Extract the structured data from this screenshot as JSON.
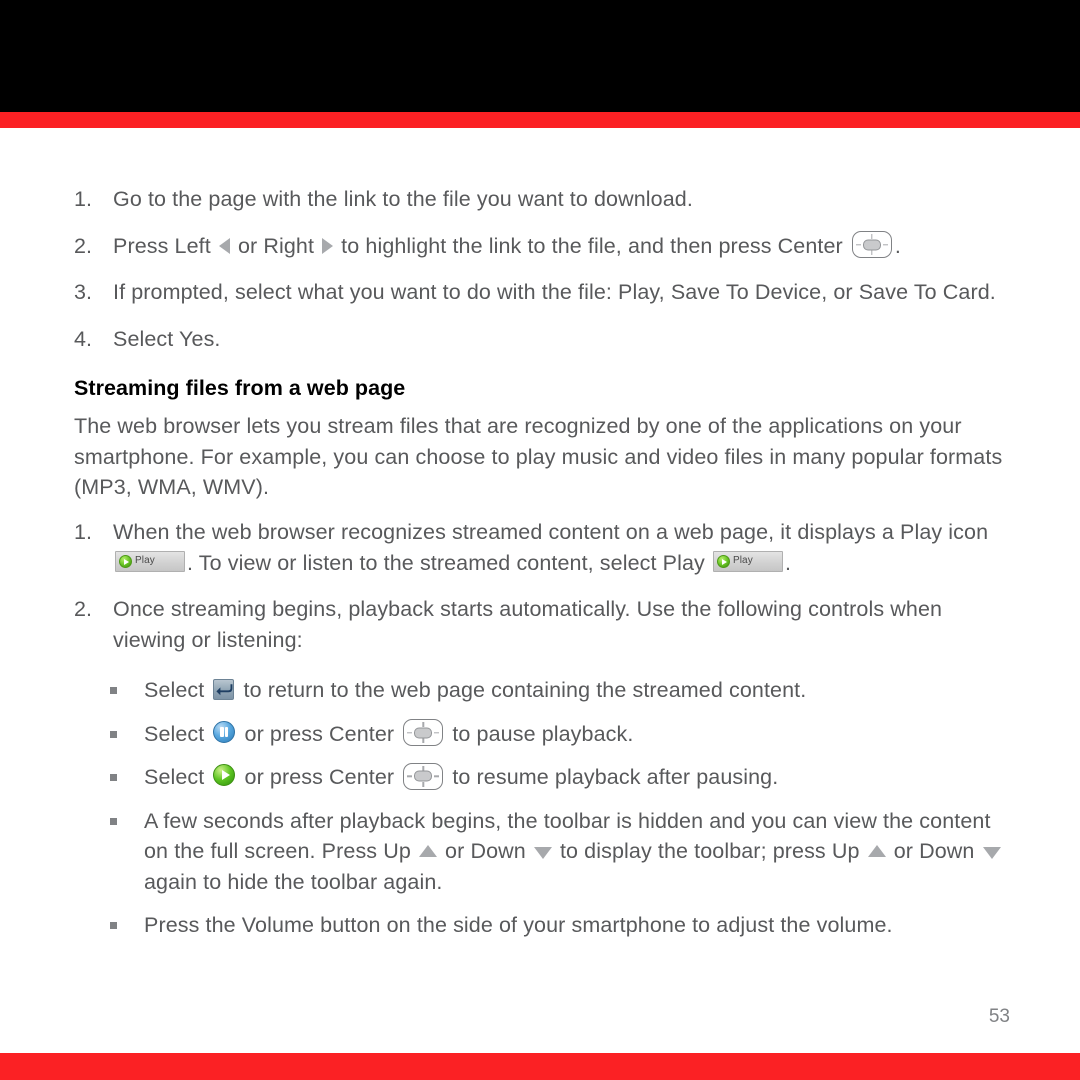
{
  "page": {
    "number": "53",
    "top_band_color": "#000000",
    "accent_color": "#fb2124",
    "body_text_color": "#58595b",
    "heading_text_color": "#000000"
  },
  "steps_download": [
    {
      "number": "1.",
      "parts": [
        {
          "type": "text",
          "value": "Go to the page with the link to the file you want to download."
        }
      ]
    },
    {
      "number": "2.",
      "parts": [
        {
          "type": "text",
          "value": "Press Left "
        },
        {
          "type": "icon",
          "icon": "left-arrow-icon"
        },
        {
          "type": "text",
          "value": " or Right "
        },
        {
          "type": "icon",
          "icon": "right-arrow-icon"
        },
        {
          "type": "text",
          "value": " to highlight the link to the file, and then press Center "
        },
        {
          "type": "icon",
          "icon": "center-dpad-icon"
        },
        {
          "type": "text",
          "value": "."
        }
      ]
    },
    {
      "number": "3.",
      "parts": [
        {
          "type": "text",
          "value": "If prompted, select what you want to do with the file: Play, Save To Device, or Save To Card."
        }
      ]
    },
    {
      "number": "4.",
      "parts": [
        {
          "type": "text",
          "value": "Select Yes."
        }
      ]
    }
  ],
  "section": {
    "heading": "Streaming files from a web page",
    "intro": "The web browser lets you stream files that are recognized by one of the applications on your smartphone. For example, you can choose to play music and video files in many popular formats (MP3, WMA, WMV)."
  },
  "steps_streaming": [
    {
      "number": "1.",
      "parts": [
        {
          "type": "text",
          "value": "When the web browser recognizes streamed content on a web page, it displays a Play icon "
        },
        {
          "type": "icon",
          "icon": "play-toolbar-button",
          "label": "Play"
        },
        {
          "type": "text",
          "value": ". To view or listen to the streamed content, select Play "
        },
        {
          "type": "icon",
          "icon": "play-toolbar-button",
          "label": "Play"
        },
        {
          "type": "text",
          "value": "."
        }
      ]
    },
    {
      "number": "2.",
      "parts": [
        {
          "type": "text",
          "value": "Once streaming begins, playback starts automatically. Use the following controls when viewing or listening:"
        }
      ]
    }
  ],
  "controls_bullets": [
    {
      "parts": [
        {
          "type": "text",
          "value": "Select "
        },
        {
          "type": "icon",
          "icon": "return-arrow-icon"
        },
        {
          "type": "text",
          "value": " to return to the web page containing the streamed content."
        }
      ]
    },
    {
      "parts": [
        {
          "type": "text",
          "value": "Select "
        },
        {
          "type": "icon",
          "icon": "pause-button-icon"
        },
        {
          "type": "text",
          "value": " or press Center "
        },
        {
          "type": "icon",
          "icon": "center-dpad-icon"
        },
        {
          "type": "text",
          "value": " to pause playback."
        }
      ]
    },
    {
      "parts": [
        {
          "type": "text",
          "value": "Select "
        },
        {
          "type": "icon",
          "icon": "play-button-icon"
        },
        {
          "type": "text",
          "value": " or press Center "
        },
        {
          "type": "icon",
          "icon": "center-dpad-icon"
        },
        {
          "type": "text",
          "value": " to resume playback after pausing."
        }
      ]
    },
    {
      "parts": [
        {
          "type": "text",
          "value": "A few seconds after playback begins, the toolbar is hidden and you can view the content on the full screen. Press Up "
        },
        {
          "type": "icon",
          "icon": "up-arrow-icon"
        },
        {
          "type": "text",
          "value": " or Down "
        },
        {
          "type": "icon",
          "icon": "down-arrow-icon"
        },
        {
          "type": "text",
          "value": " to display the toolbar; press Up "
        },
        {
          "type": "icon",
          "icon": "up-arrow-icon"
        },
        {
          "type": "text",
          "value": " or Down "
        },
        {
          "type": "icon",
          "icon": "down-arrow-icon"
        },
        {
          "type": "text",
          "value": " again to hide the toolbar again."
        }
      ]
    },
    {
      "parts": [
        {
          "type": "text",
          "value": "Press the Volume button on the side of your smartphone to adjust the volume."
        }
      ]
    }
  ]
}
